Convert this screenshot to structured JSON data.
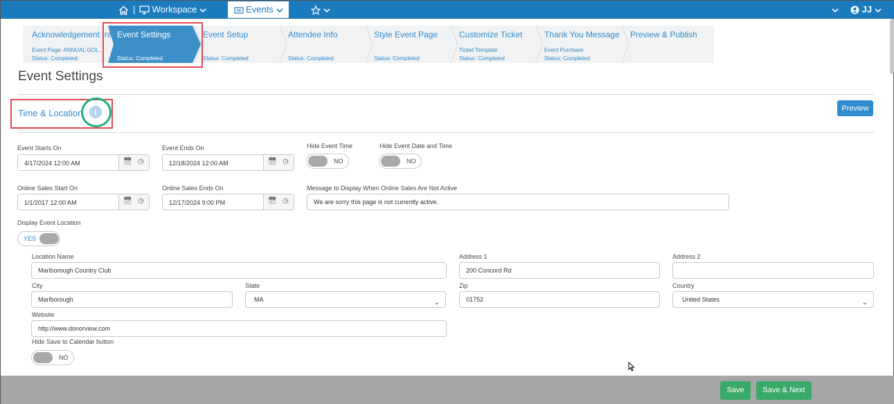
{
  "topnav": {
    "workspace_label": "Workspace",
    "events_label": "Events",
    "user_initials": "JJ",
    "separator": "|"
  },
  "wizard": {
    "steps": [
      {
        "label": "Acknowledgement Info",
        "sub1": "Event Page: ANNUAL GOL...",
        "sub2": "Status: Completed"
      },
      {
        "label": "Event Settings",
        "sub1": "",
        "sub2": "Status: Completed"
      },
      {
        "label": "Event Setup",
        "sub1": "",
        "sub2": "Status: Completed"
      },
      {
        "label": "Attendee Info",
        "sub1": "",
        "sub2": "Status: Completed"
      },
      {
        "label": "Style Event Page",
        "sub1": "",
        "sub2": "Status: Completed"
      },
      {
        "label": "Customize Ticket",
        "sub1": "Ticket Template",
        "sub2": "Status: Completed"
      },
      {
        "label": "Thank You Message",
        "sub1": "Event Purchase",
        "sub2": "Status: Completed"
      },
      {
        "label": "Preview & Publish",
        "sub1": "",
        "sub2": ""
      }
    ]
  },
  "page_title": "Event Settings",
  "section": {
    "title": "Time & Location",
    "info_glyph": "i",
    "preview_label": "Preview"
  },
  "form": {
    "event_starts_label": "Event Starts On",
    "event_starts_value": "4/17/2024 12:00 AM",
    "event_ends_label": "Event Ends On",
    "event_ends_value": "12/18/2024 12:00 AM",
    "hide_time_label": "Hide Event Time",
    "hide_time_value": "NO",
    "hide_date_time_label": "Hide Event Date and Time",
    "hide_date_time_value": "NO",
    "sales_start_label": "Online Sales Start On",
    "sales_start_value": "1/1/2017 12:00 AM",
    "sales_end_label": "Online Sales Ends On",
    "sales_end_value": "12/17/2024 9:00 PM",
    "message_label": "Message to Display When Online Sales Are Not Active",
    "message_value": "We are sorry this page is not currently active.",
    "display_location_label": "Display Event Location",
    "display_location_value": "YES",
    "location_name_label": "Location Name",
    "location_name_value": "Marlborough Country Club",
    "address1_label": "Address 1",
    "address1_value": "200 Concord Rd",
    "address2_label": "Address 2",
    "address2_value": "",
    "city_label": "City",
    "city_value": "Marlborough",
    "state_label": "State",
    "state_value": "MA",
    "zip_label": "Zip",
    "zip_value": "01752",
    "country_label": "Country",
    "country_value": "United States",
    "website_label": "Website",
    "website_value": "http://www.donorview.com",
    "hide_calendar_label": "Hide Save to Calendar button",
    "hide_calendar_value": "NO"
  },
  "footer": {
    "save_label": "Save",
    "save_next_label": "Save & Next"
  },
  "colors": {
    "nav_blue": "#1a7bbf",
    "accent_blue": "#2f8ccf",
    "active_step": "#3d8fc7",
    "highlight_red": "#e4474e",
    "highlight_green": "#1fad7f",
    "save_green": "#3aaa6a",
    "footer_gray": "#a6a6a6"
  }
}
